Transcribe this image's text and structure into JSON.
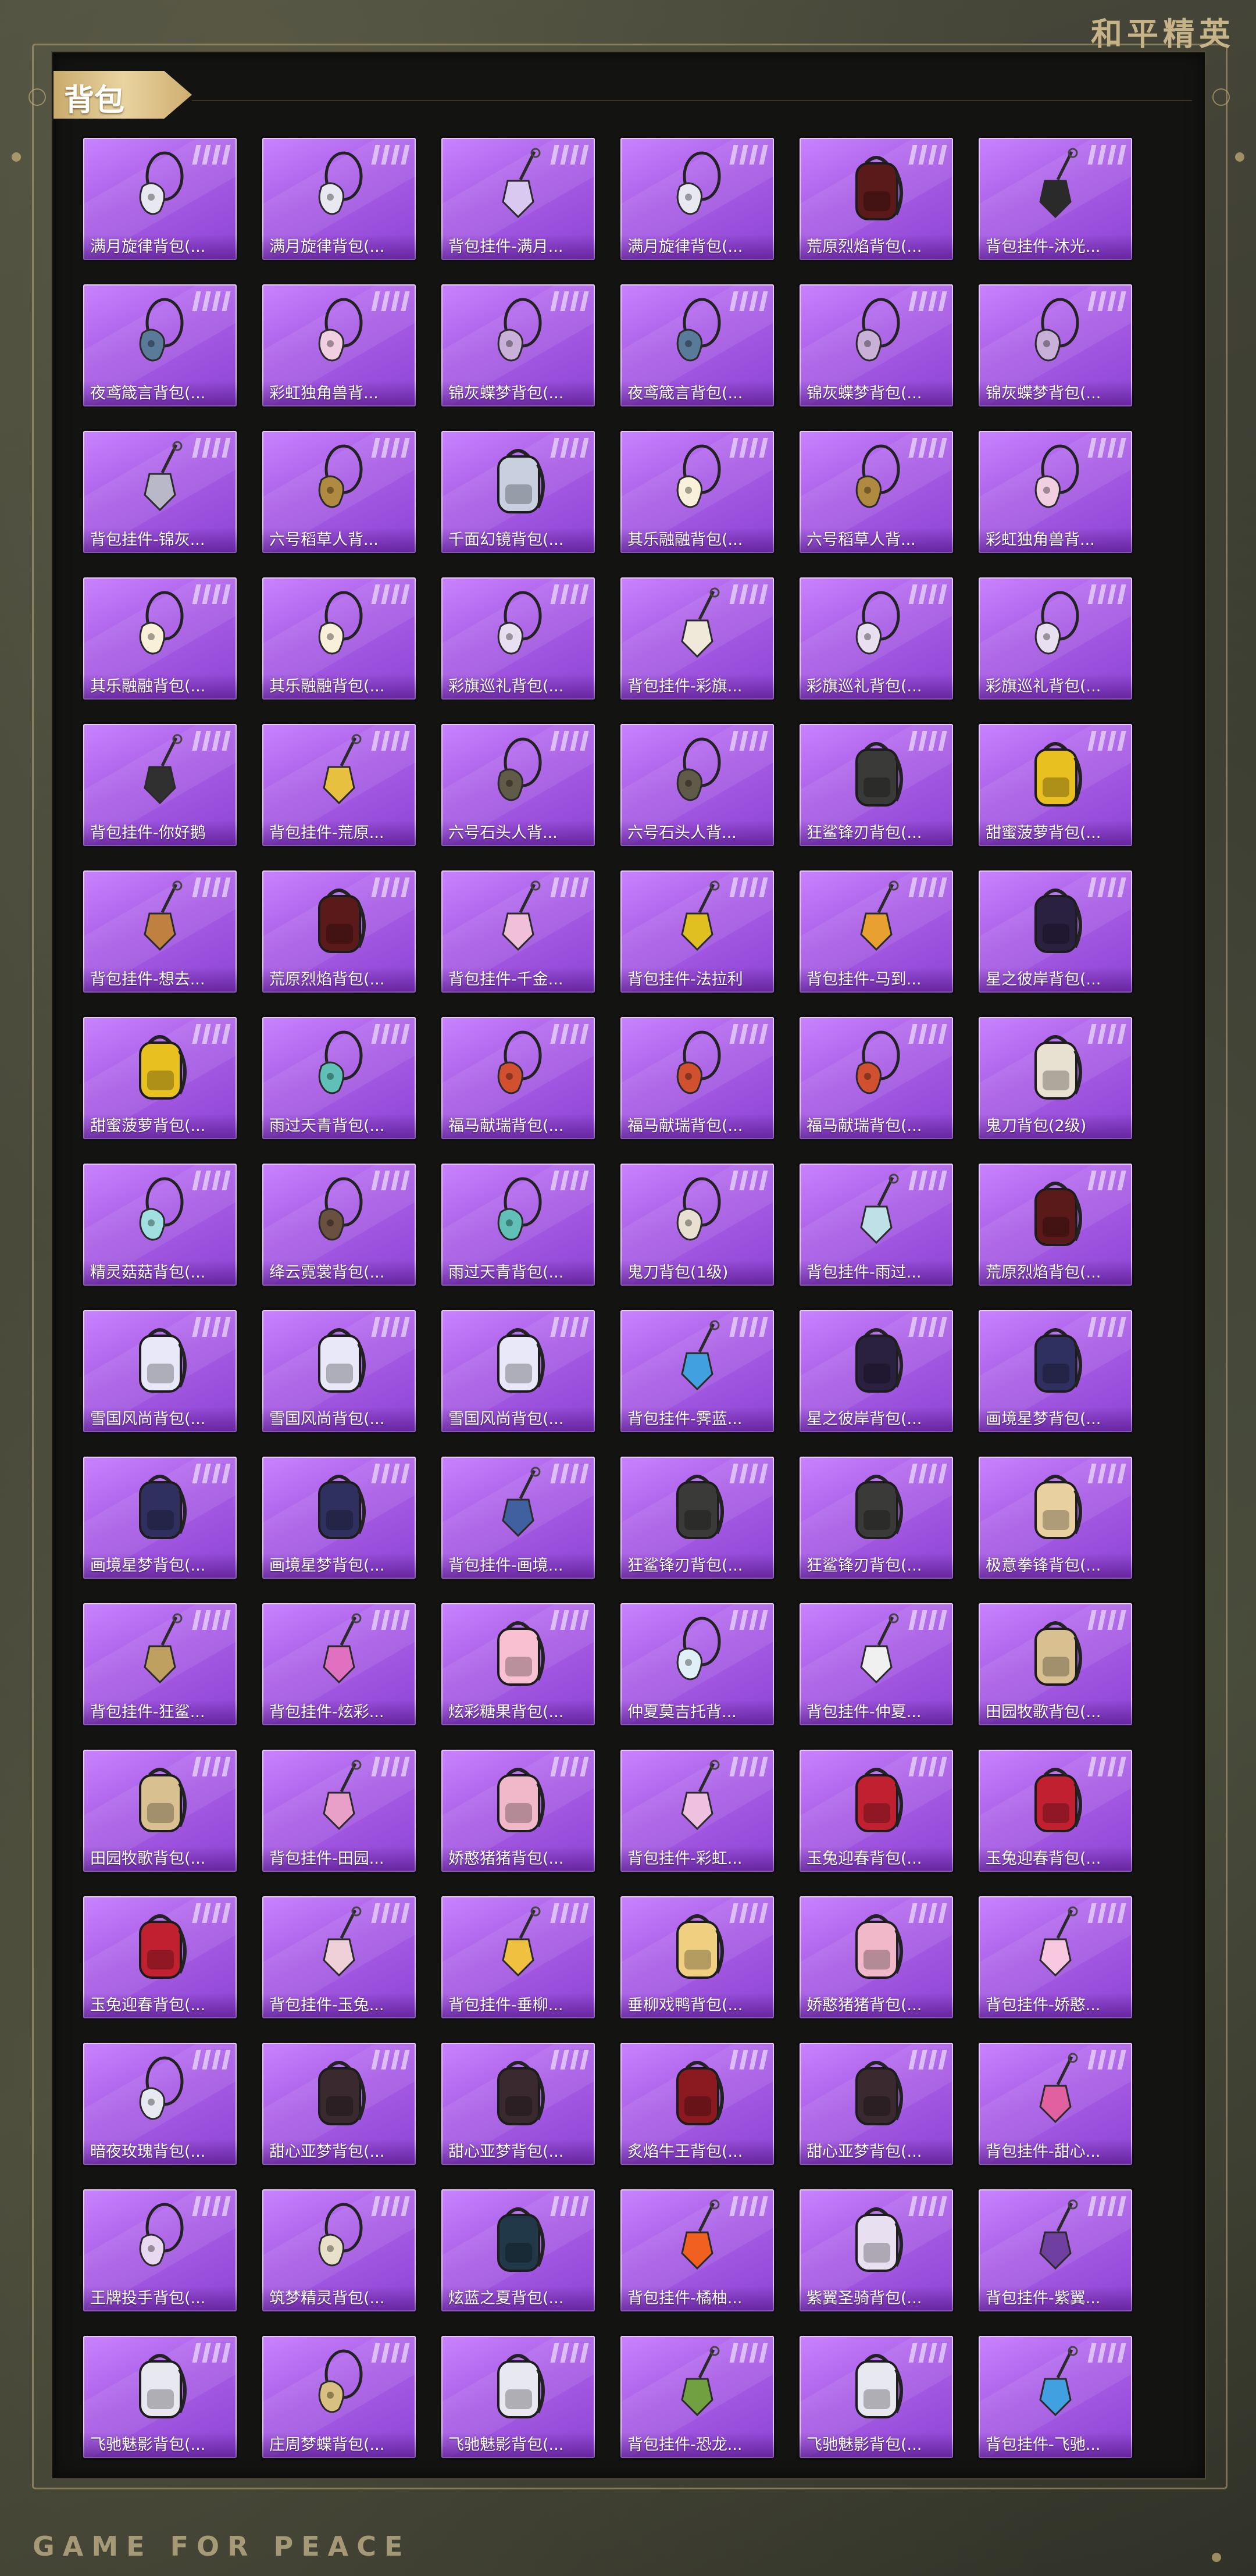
{
  "brand": "和平精英",
  "section_title": "背包",
  "footer": "GAME FOR PEACE",
  "items": [
    {
      "label": "满月旋律背包(...",
      "icon": "pendant-icon",
      "color": "#e8e8f0"
    },
    {
      "label": "满月旋律背包(...",
      "icon": "pendant-icon",
      "color": "#e8e8f0"
    },
    {
      "label": "背包挂件-满月...",
      "icon": "charm-icon",
      "color": "#d9c9f0"
    },
    {
      "label": "满月旋律背包(...",
      "icon": "pendant-icon",
      "color": "#e8e8f0"
    },
    {
      "label": "荒原烈焰背包(...",
      "icon": "backpack-icon",
      "color": "#5a1a1a"
    },
    {
      "label": "背包挂件-沐光...",
      "icon": "charm-icon",
      "color": "#2a2a2a"
    },
    {
      "label": "夜鸢箴言背包(...",
      "icon": "pendant-icon",
      "color": "#5a7a9a"
    },
    {
      "label": "彩虹独角兽背...",
      "icon": "pendant-icon",
      "color": "#f0d0e0"
    },
    {
      "label": "锦灰蝶梦背包(...",
      "icon": "pendant-icon",
      "color": "#c8b0d8"
    },
    {
      "label": "夜鸢箴言背包(...",
      "icon": "pendant-icon",
      "color": "#5a7a9a"
    },
    {
      "label": "锦灰蝶梦背包(...",
      "icon": "pendant-icon",
      "color": "#c8b0d8"
    },
    {
      "label": "锦灰蝶梦背包(...",
      "icon": "pendant-icon",
      "color": "#c8b0d8"
    },
    {
      "label": "背包挂件-锦灰...",
      "icon": "charm-icon",
      "color": "#b8b8c8"
    },
    {
      "label": "六号稻草人背...",
      "icon": "pendant-icon",
      "color": "#b08a40"
    },
    {
      "label": "千面幻镜背包(...",
      "icon": "backpack-icon",
      "color": "#c8d0e0"
    },
    {
      "label": "其乐融融背包(...",
      "icon": "pendant-icon",
      "color": "#f8f0d8"
    },
    {
      "label": "六号稻草人背...",
      "icon": "pendant-icon",
      "color": "#b08a40"
    },
    {
      "label": "彩虹独角兽背...",
      "icon": "pendant-icon",
      "color": "#f0d0e0"
    },
    {
      "label": "其乐融融背包(...",
      "icon": "pendant-icon",
      "color": "#f8f0d8"
    },
    {
      "label": "其乐融融背包(...",
      "icon": "pendant-icon",
      "color": "#f8f0d8"
    },
    {
      "label": "彩旗巡礼背包(...",
      "icon": "pendant-icon",
      "color": "#e8e0f0"
    },
    {
      "label": "背包挂件-彩旗...",
      "icon": "charm-icon",
      "color": "#f0e8d8"
    },
    {
      "label": "彩旗巡礼背包(...",
      "icon": "pendant-icon",
      "color": "#e8e0f0"
    },
    {
      "label": "彩旗巡礼背包(...",
      "icon": "pendant-icon",
      "color": "#e8e0f0"
    },
    {
      "label": "背包挂件-你好鹅",
      "icon": "charm-icon",
      "color": "#303030"
    },
    {
      "label": "背包挂件-荒原...",
      "icon": "charm-icon",
      "color": "#e8c040"
    },
    {
      "label": "六号石头人背...",
      "icon": "pendant-icon",
      "color": "#605a48"
    },
    {
      "label": "六号石头人背...",
      "icon": "pendant-icon",
      "color": "#605a48"
    },
    {
      "label": "狂鲨锋刃背包(...",
      "icon": "backpack-icon",
      "color": "#3a3a38"
    },
    {
      "label": "甜蜜菠萝背包(...",
      "icon": "backpack-icon",
      "color": "#e8c020"
    },
    {
      "label": "背包挂件-想去...",
      "icon": "charm-icon",
      "color": "#c08040"
    },
    {
      "label": "荒原烈焰背包(...",
      "icon": "backpack-icon",
      "color": "#5a1a1a"
    },
    {
      "label": "背包挂件-千金...",
      "icon": "charm-icon",
      "color": "#f0c0d8"
    },
    {
      "label": "背包挂件-法拉利",
      "icon": "charm-icon",
      "color": "#e0c020"
    },
    {
      "label": "背包挂件-马到...",
      "icon": "charm-icon",
      "color": "#e8a030"
    },
    {
      "label": "星之彼岸背包(...",
      "icon": "backpack-icon",
      "color": "#2a2040"
    },
    {
      "label": "甜蜜菠萝背包(...",
      "icon": "backpack-icon",
      "color": "#e8c020"
    },
    {
      "label": "雨过天青背包(...",
      "icon": "pendant-icon",
      "color": "#60c0b8"
    },
    {
      "label": "福马献瑞背包(...",
      "icon": "pendant-icon",
      "color": "#d05030"
    },
    {
      "label": "福马献瑞背包(...",
      "icon": "pendant-icon",
      "color": "#d05030"
    },
    {
      "label": "福马献瑞背包(...",
      "icon": "pendant-icon",
      "color": "#d05030"
    },
    {
      "label": "鬼刀背包(2级)",
      "icon": "backpack-icon",
      "color": "#e8e0d0"
    },
    {
      "label": "精灵菇菇背包(...",
      "icon": "pendant-icon",
      "color": "#a0e0e0"
    },
    {
      "label": "绛云霓裳背包(...",
      "icon": "pendant-icon",
      "color": "#6a5040"
    },
    {
      "label": "雨过天青背包(...",
      "icon": "pendant-icon",
      "color": "#60c0b8"
    },
    {
      "label": "鬼刀背包(1级)",
      "icon": "pendant-icon",
      "color": "#e8e0d0"
    },
    {
      "label": "背包挂件-雨过...",
      "icon": "charm-icon",
      "color": "#c0e0e8"
    },
    {
      "label": "荒原烈焰背包(...",
      "icon": "backpack-icon",
      "color": "#5a1a1a"
    },
    {
      "label": "雪国风尚背包(...",
      "icon": "backpack-icon",
      "color": "#e8e8f8"
    },
    {
      "label": "雪国风尚背包(...",
      "icon": "backpack-icon",
      "color": "#e8e8f8"
    },
    {
      "label": "雪国风尚背包(...",
      "icon": "backpack-icon",
      "color": "#e8e8f8"
    },
    {
      "label": "背包挂件-霁蓝...",
      "icon": "charm-icon",
      "color": "#40a0e0"
    },
    {
      "label": "星之彼岸背包(...",
      "icon": "backpack-icon",
      "color": "#2a2040"
    },
    {
      "label": "画境星梦背包(...",
      "icon": "backpack-icon",
      "color": "#303060"
    },
    {
      "label": "画境星梦背包(...",
      "icon": "backpack-icon",
      "color": "#303060"
    },
    {
      "label": "画境星梦背包(...",
      "icon": "backpack-icon",
      "color": "#303060"
    },
    {
      "label": "背包挂件-画境...",
      "icon": "charm-icon",
      "color": "#4060a0"
    },
    {
      "label": "狂鲨锋刃背包(...",
      "icon": "backpack-icon",
      "color": "#3a3a38"
    },
    {
      "label": "狂鲨锋刃背包(...",
      "icon": "backpack-icon",
      "color": "#3a3a38"
    },
    {
      "label": "极意拳锋背包(...",
      "icon": "backpack-icon",
      "color": "#e8d0a0"
    },
    {
      "label": "背包挂件-狂鲨...",
      "icon": "charm-icon",
      "color": "#c0a060"
    },
    {
      "label": "背包挂件-炫彩...",
      "icon": "charm-icon",
      "color": "#e070c0"
    },
    {
      "label": "炫彩糖果背包(...",
      "icon": "backpack-icon",
      "color": "#f8c0d0"
    },
    {
      "label": "仲夏莫吉托背...",
      "icon": "pendant-icon",
      "color": "#e0f0f8"
    },
    {
      "label": "背包挂件-仲夏...",
      "icon": "charm-icon",
      "color": "#f0f0f0"
    },
    {
      "label": "田园牧歌背包(...",
      "icon": "backpack-icon",
      "color": "#d8c090"
    },
    {
      "label": "田园牧歌背包(...",
      "icon": "backpack-icon",
      "color": "#d8c090"
    },
    {
      "label": "背包挂件-田园...",
      "icon": "charm-icon",
      "color": "#e8a0c8"
    },
    {
      "label": "娇憨猪猪背包(...",
      "icon": "backpack-icon",
      "color": "#f0b8c8"
    },
    {
      "label": "背包挂件-彩虹...",
      "icon": "charm-icon",
      "color": "#f0c0e0"
    },
    {
      "label": "玉兔迎春背包(...",
      "icon": "backpack-icon",
      "color": "#c02030"
    },
    {
      "label": "玉兔迎春背包(...",
      "icon": "backpack-icon",
      "color": "#c02030"
    },
    {
      "label": "玉兔迎春背包(...",
      "icon": "backpack-icon",
      "color": "#c02030"
    },
    {
      "label": "背包挂件-玉兔...",
      "icon": "charm-icon",
      "color": "#f0d0d8"
    },
    {
      "label": "背包挂件-垂柳...",
      "icon": "charm-icon",
      "color": "#f0c040"
    },
    {
      "label": "垂柳戏鸭背包(...",
      "icon": "backpack-icon",
      "color": "#f0d080"
    },
    {
      "label": "娇憨猪猪背包(...",
      "icon": "backpack-icon",
      "color": "#f0b8c8"
    },
    {
      "label": "背包挂件-娇憨...",
      "icon": "charm-icon",
      "color": "#f8c8e0"
    },
    {
      "label": "暗夜玫瑰背包(...",
      "icon": "pendant-icon",
      "color": "#e8e8f0"
    },
    {
      "label": "甜心亚梦背包(...",
      "icon": "backpack-icon",
      "color": "#3a2a30"
    },
    {
      "label": "甜心亚梦背包(...",
      "icon": "backpack-icon",
      "color": "#3a2a30"
    },
    {
      "label": "炙焰牛王背包(...",
      "icon": "backpack-icon",
      "color": "#8a1a20"
    },
    {
      "label": "甜心亚梦背包(...",
      "icon": "backpack-icon",
      "color": "#3a2a30"
    },
    {
      "label": "背包挂件-甜心...",
      "icon": "charm-icon",
      "color": "#e060a0"
    },
    {
      "label": "王牌投手背包(...",
      "icon": "pendant-icon",
      "color": "#e8d8f0"
    },
    {
      "label": "筑梦精灵背包(...",
      "icon": "pendant-icon",
      "color": "#e8e0c8"
    },
    {
      "label": "炫蓝之夏背包(...",
      "icon": "backpack-icon",
      "color": "#203848"
    },
    {
      "label": "背包挂件-橘柚...",
      "icon": "charm-icon",
      "color": "#f06020"
    },
    {
      "label": "紫翼圣骑背包(...",
      "icon": "backpack-icon",
      "color": "#e8e0f0"
    },
    {
      "label": "背包挂件-紫翼...",
      "icon": "charm-icon",
      "color": "#7040a0"
    },
    {
      "label": "飞驰魅影背包(...",
      "icon": "backpack-icon",
      "color": "#e8e8f0"
    },
    {
      "label": "庄周梦蝶背包(...",
      "icon": "pendant-icon",
      "color": "#d8c080"
    },
    {
      "label": "飞驰魅影背包(...",
      "icon": "backpack-icon",
      "color": "#e8e8f0"
    },
    {
      "label": "背包挂件-恐龙...",
      "icon": "charm-icon",
      "color": "#70a040"
    },
    {
      "label": "飞驰魅影背包(...",
      "icon": "backpack-icon",
      "color": "#e8e8f0"
    },
    {
      "label": "背包挂件-飞驰...",
      "icon": "charm-icon",
      "color": "#40a0e0"
    }
  ]
}
